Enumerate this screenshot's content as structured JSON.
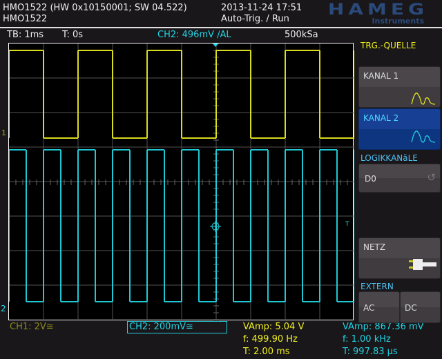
{
  "header": {
    "device_info": "HMO1522 (HW 0x10150001; SW 04.522)",
    "device_name": "HMO1522",
    "datetime": "2013-11-24 17:51",
    "trigger_state": "Auto-Trig. / Run",
    "logo": "HAMEG",
    "logo_sub": "Instruments"
  },
  "status": {
    "timebase": "TB: 1ms",
    "trigger_time": "T: 0s",
    "trigger_level": "CH2: 496mV ∕AL",
    "sample_rate": "500kSa"
  },
  "channels": {
    "ch1_label": "CH1: 2V≅",
    "ch2_label": "CH2: 200mV≅",
    "ch1_marker": "1",
    "ch2_marker": "2",
    "trigger_marker": "T"
  },
  "measurements": {
    "ch1": {
      "vamp": "VAmp: 5.04 V",
      "freq": "f: 499.90 Hz",
      "period": "T: 2.00 ms"
    },
    "ch2": {
      "vamp": "VAmp: 867.36 mV",
      "freq": "f: 1.00 kHz",
      "period": "T: 997.83 µs"
    }
  },
  "menu": {
    "title": "TRG.-QUELLE",
    "kanal1": "KANAL 1",
    "kanal2": "KANAL 2",
    "logic_header": "LOGIKKANäLE",
    "d0": "D0",
    "netz": "NETZ",
    "extern_header": "EXTERN",
    "ac": "AC",
    "dc": "DC"
  },
  "colors": {
    "ch1": "#e6e61e",
    "ch2": "#22d3e0",
    "grid": "#555555",
    "selected": "#0d3580"
  },
  "waveforms": {
    "ch1_period_ms": 2.0,
    "ch2_period_ms": 1.0,
    "timebase_ms_per_div": 1
  }
}
